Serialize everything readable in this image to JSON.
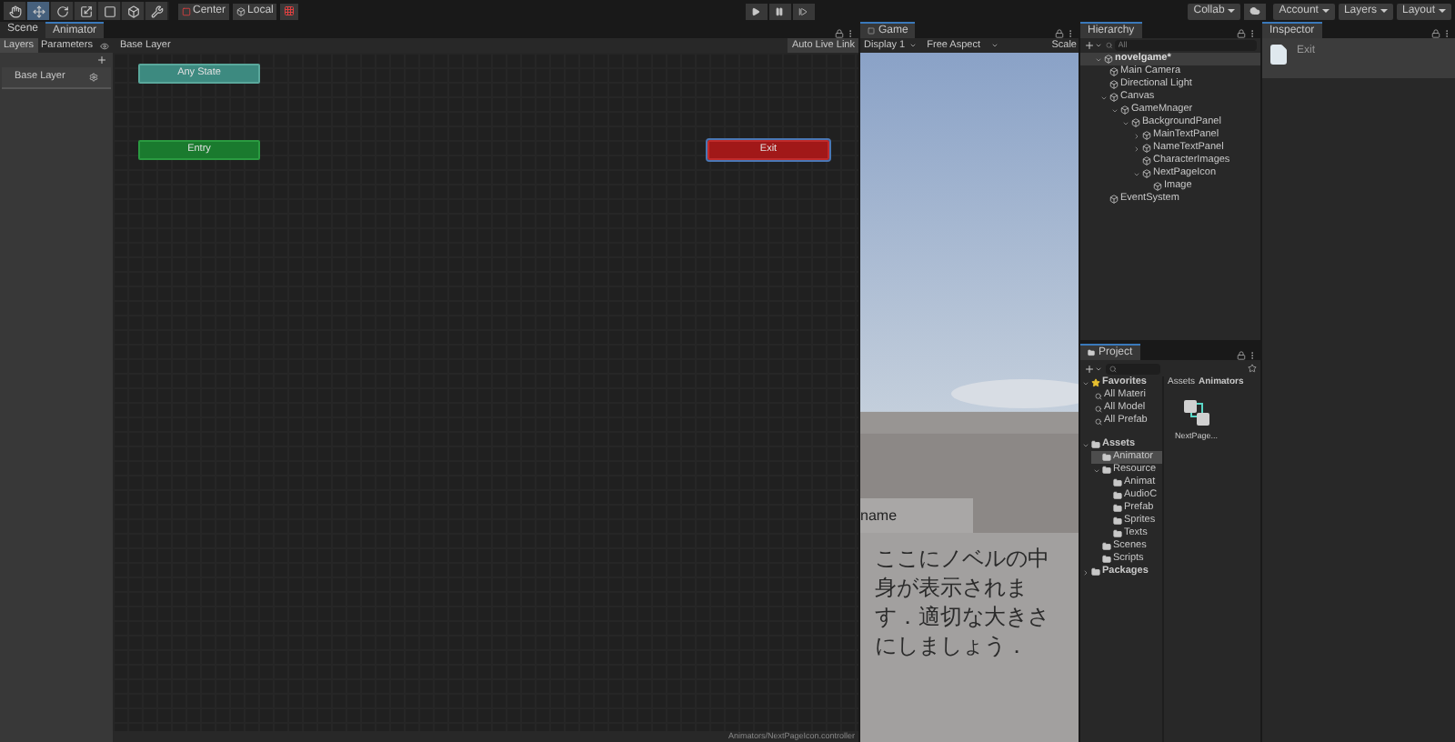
{
  "toolbar": {
    "tools": [
      {
        "kind": "hand",
        "selected": false
      },
      {
        "kind": "move",
        "selected": true
      },
      {
        "kind": "rotate",
        "selected": false
      },
      {
        "kind": "scale",
        "selected": false
      },
      {
        "kind": "rect",
        "selected": false
      },
      {
        "kind": "transform",
        "selected": false
      },
      {
        "kind": "custom",
        "selected": false
      }
    ],
    "pivot": "Center",
    "space": "Local",
    "collab": "Collab",
    "account": "Account",
    "layers": "Layers",
    "layout": "Layout"
  },
  "animator": {
    "tabs": [
      {
        "label": "Scene",
        "selected": false
      },
      {
        "label": "Animator",
        "selected": true
      }
    ],
    "panel_tabs": [
      {
        "label": "Layers",
        "selected": true
      },
      {
        "label": "Parameters",
        "selected": false
      }
    ],
    "breadcrumb": "Base Layer",
    "auto_live_link": "Auto Live Link",
    "layers": [
      {
        "name": "Base Layer"
      }
    ],
    "states": [
      {
        "name": "Any State",
        "kind": "any",
        "selected": false
      },
      {
        "name": "Entry",
        "kind": "entry",
        "selected": false
      },
      {
        "name": "Exit",
        "kind": "exit",
        "selected": true
      }
    ],
    "status": "Animators/NextPageIcon.controller"
  },
  "game": {
    "tab": "Game",
    "display": "Display 1",
    "aspect": "Free Aspect",
    "scale": "Scale",
    "name_label": "name",
    "message": "ここにノベルの中身が表示されます．適切な大きさにしましょう．"
  },
  "hierarchy": {
    "tab": "Hierarchy",
    "placeholder": "All",
    "scene": "novelgame*",
    "items": [
      {
        "label": "Main Camera"
      },
      {
        "label": "Directional Light"
      },
      {
        "label": "Canvas",
        "expanded": true,
        "children": [
          {
            "label": "GameMnager",
            "expanded": true,
            "children": [
              {
                "label": "BackgroundPanel",
                "expanded": true,
                "children": [
                  {
                    "label": "MainTextPanel",
                    "expanded": false
                  },
                  {
                    "label": "NameTextPanel",
                    "expanded": false
                  },
                  {
                    "label": "CharacterImages"
                  },
                  {
                    "label": "NextPageIcon",
                    "expanded": true,
                    "children": [
                      {
                        "label": "Image"
                      }
                    ]
                  }
                ]
              }
            ]
          }
        ]
      },
      {
        "label": "EventSystem"
      }
    ]
  },
  "project": {
    "tab": "Project",
    "favorites": {
      "label": "Favorites",
      "items": [
        "All Materi",
        "All Model",
        "All Prefab"
      ]
    },
    "tree": [
      {
        "label": "Assets",
        "bold": true,
        "expanded": true,
        "children": [
          {
            "label": "Animator",
            "selected": true
          },
          {
            "label": "Resource",
            "expanded": true,
            "children": [
              {
                "label": "Animat"
              },
              {
                "label": "AudioC"
              },
              {
                "label": "Prefab"
              },
              {
                "label": "Sprites"
              },
              {
                "label": "Texts"
              }
            ]
          },
          {
            "label": "Scenes"
          },
          {
            "label": "Scripts"
          }
        ]
      },
      {
        "label": "Packages",
        "bold": true,
        "expanded": false
      }
    ],
    "breadcrumb": [
      "Assets",
      "Animators"
    ],
    "assets": [
      {
        "name": "NextPage..."
      }
    ]
  },
  "inspector": {
    "tab": "Inspector",
    "object": "Exit"
  }
}
